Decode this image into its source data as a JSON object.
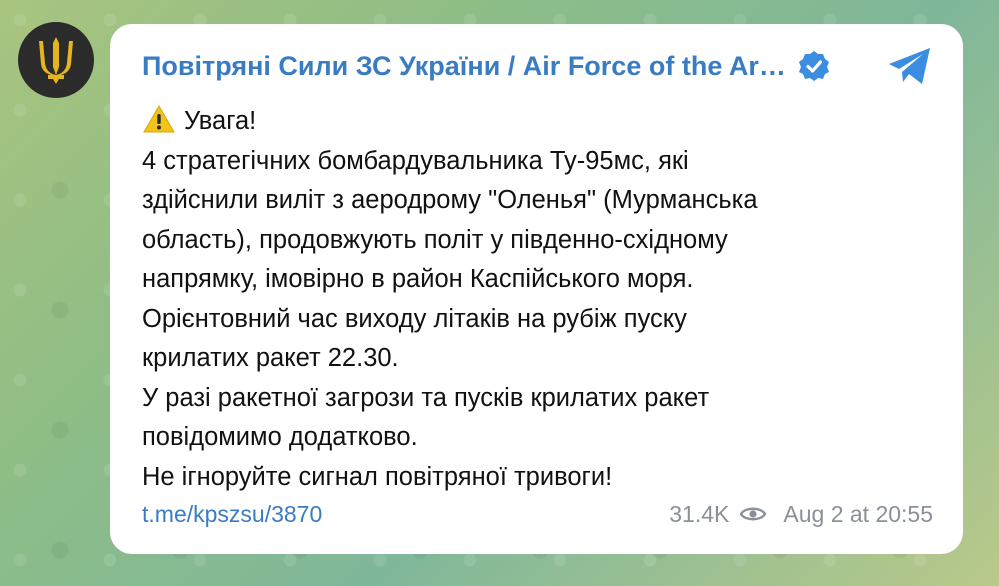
{
  "channel": {
    "name": "Повітряні Сили ЗС України / Air Force of the Ar…",
    "avatar_icon": "trident-icon",
    "verified_icon": "verified-badge-icon",
    "share_icon": "telegram-share-icon"
  },
  "message": {
    "warning_icon": "warning-icon",
    "lines": [
      "Увага!",
      "4 стратегічних бомбардувальника Ту-95мс, які",
      "здійснили виліт з аеродрому \"Оленья\" (Мурманська",
      "область), продовжують політ у південно-східному",
      "напрямку, імовірно в район Каспійського моря.",
      "Орієнтовний час виходу літаків на рубіж пуску",
      "крилатих ракет 22.30.",
      "У разі ракетної загрози та пусків крилатих ракет",
      "повідомимо додатково.",
      "Не ігноруйте сигнал повітряної тривоги!"
    ]
  },
  "footer": {
    "link": "t.me/kpszsu/3870",
    "views": "31.4K",
    "views_icon": "eye-icon",
    "timestamp": "Aug 2 at 20:55"
  },
  "colors": {
    "accent": "#3a7cc2",
    "bubble": "#ffffff",
    "meta_text": "#8a9099"
  }
}
